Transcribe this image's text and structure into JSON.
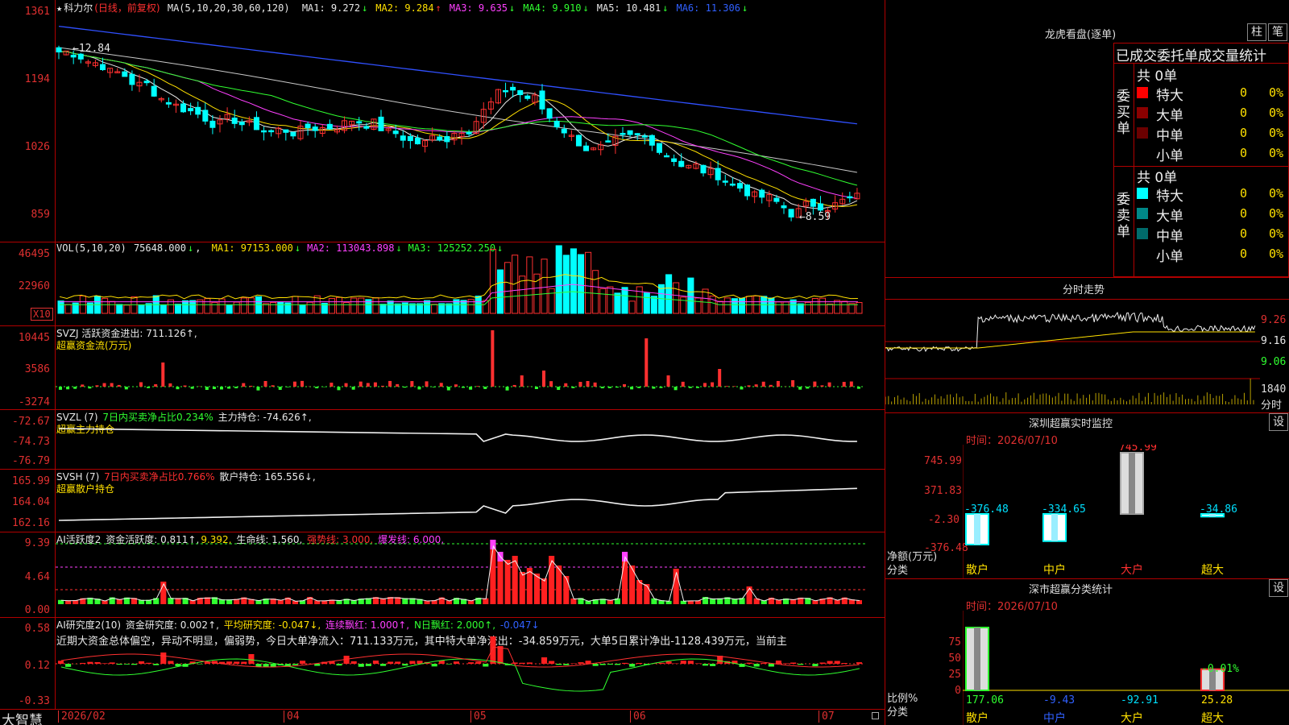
{
  "stock": {
    "star": "★",
    "name": "科力尔",
    "mode": "(日线，前复权)"
  },
  "ma_header": {
    "label": "MA(5,10,20,30,60,120)",
    "items": [
      {
        "k": "MA1:",
        "v": "9.272",
        "arrow": "↓",
        "color": "#e8e8e8"
      },
      {
        "k": "MA2:",
        "v": "9.284",
        "arrow": "↑",
        "color": "#ffe000"
      },
      {
        "k": "MA3:",
        "v": "9.635",
        "arrow": "↓",
        "color": "#ff40ff"
      },
      {
        "k": "MA4:",
        "v": "9.910",
        "arrow": "↓",
        "color": "#30ff30"
      },
      {
        "k": "MA5:",
        "v": "10.481",
        "arrow": "↓",
        "color": "#e8e8e8"
      },
      {
        "k": "MA6:",
        "v": "11.306",
        "arrow": "↓",
        "color": "#3060ff"
      }
    ]
  },
  "price_axis": [
    "1361",
    "1194",
    "1026",
    "859"
  ],
  "price_labels": {
    "high": "12.84",
    "low": "8.59"
  },
  "vol": {
    "label": "VOL(5,10,20)",
    "value": "75648.000",
    "arrow": "↓",
    "items": [
      {
        "k": "MA1:",
        "v": "97153.000",
        "arrow": "↓",
        "color": "#ffe000"
      },
      {
        "k": "MA2:",
        "v": "113043.898",
        "arrow": "↓",
        "color": "#ff40ff"
      },
      {
        "k": "MA3:",
        "v": "125252.250",
        "arrow": "↓",
        "color": "#30ff30"
      }
    ],
    "axis": [
      "46495",
      "22960"
    ],
    "unit": "X10"
  },
  "svzj": {
    "line1": "SVZJ  活跃资金进出: 711.126↑,",
    "line2": "超赢资金流(万元)",
    "axis": [
      "10445",
      "3586",
      "-3274"
    ]
  },
  "svzl": {
    "line1a": "SVZL (7)",
    "line1b": "7日内买卖净占比0.234%",
    "line1c": "主力持仓: -74.626↑,",
    "line2": "超赢主力持仓",
    "axis": [
      "-72.67",
      "-74.73",
      "-76.79"
    ]
  },
  "svsh": {
    "line1a": "SVSH (7)",
    "line1b": "7日内买卖净占比0.766%",
    "line1c": "散户持仓: 165.556↓,",
    "line2": "超赢散户持仓",
    "axis": [
      "165.99",
      "164.04",
      "162.16"
    ]
  },
  "ai_active": {
    "label": "AI活跃度2",
    "k1": "资金活跃度: 0.811↑,",
    "k1b": "9.392,",
    "k2": "生命线: 1.560,",
    "k3": "强势线: 3.000,",
    "k4": "爆发线: 6.000,",
    "axis": [
      "9.39",
      "4.64",
      "0.00"
    ]
  },
  "ai_research": {
    "label": "AI研究度2(10)",
    "k1": "资金研究度: 0.002↑,",
    "k2": "平均研究度: -0.047↓,",
    "k3": "连续飘红: 1.000↑,",
    "k4": "N日飘红: 2.000↑,",
    "k5": "-0.047↓",
    "text": "近期大资金总体偏空，异动不明显，偏弱势，今日大单净流入：711.133万元，其中特大单净流出：-34.859万元，大单5日累计净出-1128.439万元，当前主",
    "axis": [
      "0.58",
      "0.12",
      "-0.33"
    ]
  },
  "date_axis": {
    "brand": "大智慧",
    "labels": [
      "2026/02",
      "04",
      "05",
      "06",
      "07"
    ]
  },
  "dragon": {
    "title": "龙虎看盘(逐单)",
    "btn1": "柱",
    "btn2": "笔",
    "subtitle": "已成交委托单成交量统计",
    "buy_label": "委买单",
    "sell_label": "委卖单",
    "buy_total": "共 0单",
    "sell_total": "共 0单",
    "buy_rows": [
      {
        "label": "特大",
        "num": "0",
        "pct": "0%",
        "color": "#ff0000"
      },
      {
        "label": "大单",
        "num": "0",
        "pct": "0%",
        "color": "#8b0000"
      },
      {
        "label": "中单",
        "num": "0",
        "pct": "0%",
        "color": "#6b0000"
      },
      {
        "label": "小单",
        "num": "0",
        "pct": "0%",
        "color": "#000000"
      }
    ],
    "sell_rows": [
      {
        "label": "特大",
        "num": "0",
        "pct": "0%",
        "color": "#00ffff"
      },
      {
        "label": "大单",
        "num": "0",
        "pct": "0%",
        "color": "#008888"
      },
      {
        "label": "中单",
        "num": "0",
        "pct": "0%",
        "color": "#006b6b"
      },
      {
        "label": "小单",
        "num": "0",
        "pct": "0%",
        "color": "#000000"
      }
    ]
  },
  "intraday": {
    "title": "分时走势",
    "axis": [
      "9.26",
      "9.16",
      "9.06"
    ],
    "vol_label": "1840",
    "vol_unit": "分时"
  },
  "monitor": {
    "title": "深圳超赢实时监控",
    "btn": "设",
    "date": "时间：2026/07/10",
    "axis": [
      "745.99",
      "371.83",
      "-2.30",
      "-376.48"
    ],
    "ylabel": "净额(万元)",
    "xlabel": "分类",
    "bars": [
      {
        "cat": "散户",
        "value": "-376.48"
      },
      {
        "cat": "中户",
        "value": "-334.65"
      },
      {
        "cat": "大户",
        "value": "745.99"
      },
      {
        "cat": "超大",
        "value": "-34.86"
      }
    ]
  },
  "classify": {
    "title": "深市超赢分类统计",
    "btn": "设",
    "date": "时间：2026/07/10",
    "axis": [
      "75",
      "50",
      "25",
      "0"
    ],
    "ylabel": "比例%",
    "xlabel": "分类",
    "bars": [
      {
        "cat": "散户",
        "value": "177.06",
        "label_color": "#30ff30"
      },
      {
        "cat": "中户",
        "value": "-9.43",
        "label_color": "#3060ff"
      },
      {
        "cat": "大户",
        "value": "-92.91",
        "label_color": "#00e0ff"
      },
      {
        "cat": "超大",
        "value": "25.28",
        "label_color": "#ffe000"
      }
    ],
    "extra": "-0.01%"
  }
}
